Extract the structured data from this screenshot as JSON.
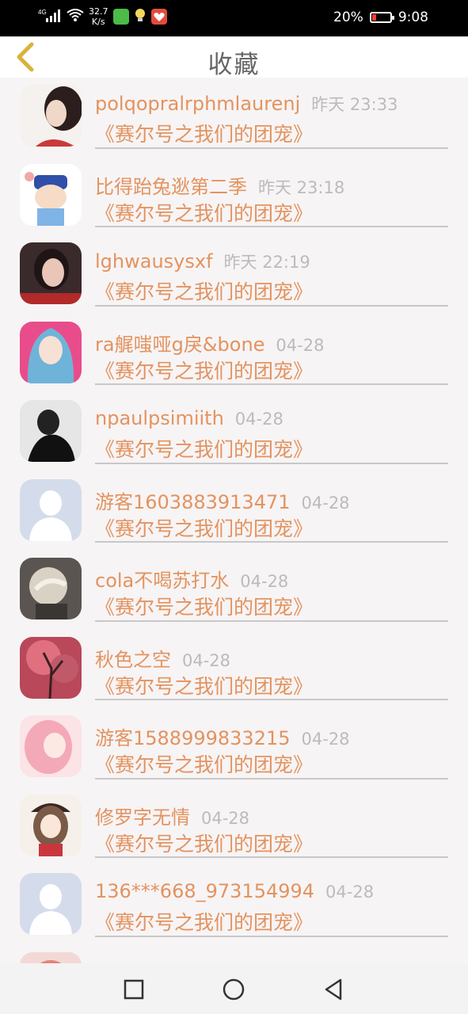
{
  "status_bar": {
    "signal": "4G",
    "net_speed": "32.7",
    "net_speed_unit": "K/s",
    "battery": "20%",
    "time": "9:08"
  },
  "header": {
    "title": "收藏"
  },
  "items": [
    {
      "name": "polqopralrphmlaurenj",
      "time": "昨天 23:33",
      "subtitle": "《赛尔号之我们的团宠》",
      "avatar": "woman-portrait-avatar"
    },
    {
      "name": "比得跆兔逖第二季",
      "time": "昨天 23:18",
      "subtitle": "《赛尔号之我们的团宠》",
      "avatar": "cartoon-character-avatar"
    },
    {
      "name": "lghwausysxf",
      "time": "昨天 22:19",
      "subtitle": "《赛尔号之我们的团宠》",
      "avatar": "girl-photo-avatar"
    },
    {
      "name": "ra艉嗤哑g戾&bone",
      "time": "04-28",
      "subtitle": "《赛尔号之我们的团宠》",
      "avatar": "veiled-woman-avatar"
    },
    {
      "name": "npaulpsimiith",
      "time": "04-28",
      "subtitle": "《赛尔号之我们的团宠》",
      "avatar": "monochrome-man-avatar"
    },
    {
      "name": "游客1603883913471",
      "time": "04-28",
      "subtitle": "《赛尔号之我们的团宠》",
      "avatar": "default-user-avatar"
    },
    {
      "name": "cola不喝苏打水",
      "time": "04-28",
      "subtitle": "《赛尔号之我们的团宠》",
      "avatar": "anime-character-avatar"
    },
    {
      "name": "秋色之空",
      "time": "04-28",
      "subtitle": "《赛尔号之我们的团宠》",
      "avatar": "autumn-tree-avatar"
    },
    {
      "name": "游客1588999833215",
      "time": "04-28",
      "subtitle": "《赛尔号之我们的团宠》",
      "avatar": "pink-anime-girl-avatar"
    },
    {
      "name": "修罗字无情",
      "time": "04-28",
      "subtitle": "《赛尔号之我们的团宠》",
      "avatar": "anime-girl-hat-avatar"
    },
    {
      "name": "136***668_973154994",
      "time": "04-28",
      "subtitle": "《赛尔号之我们的团宠》",
      "avatar": "default-user-avatar"
    },
    {
      "name": "",
      "time": "",
      "subtitle": "",
      "avatar": "partial-avatar"
    }
  ],
  "colors": {
    "accent": "#e3935f",
    "back_icon": "#d8b33c",
    "time_text": "#bbbbbb"
  },
  "nav_bar": {
    "icons": [
      "square-icon",
      "circle-icon",
      "triangle-back-icon"
    ]
  }
}
